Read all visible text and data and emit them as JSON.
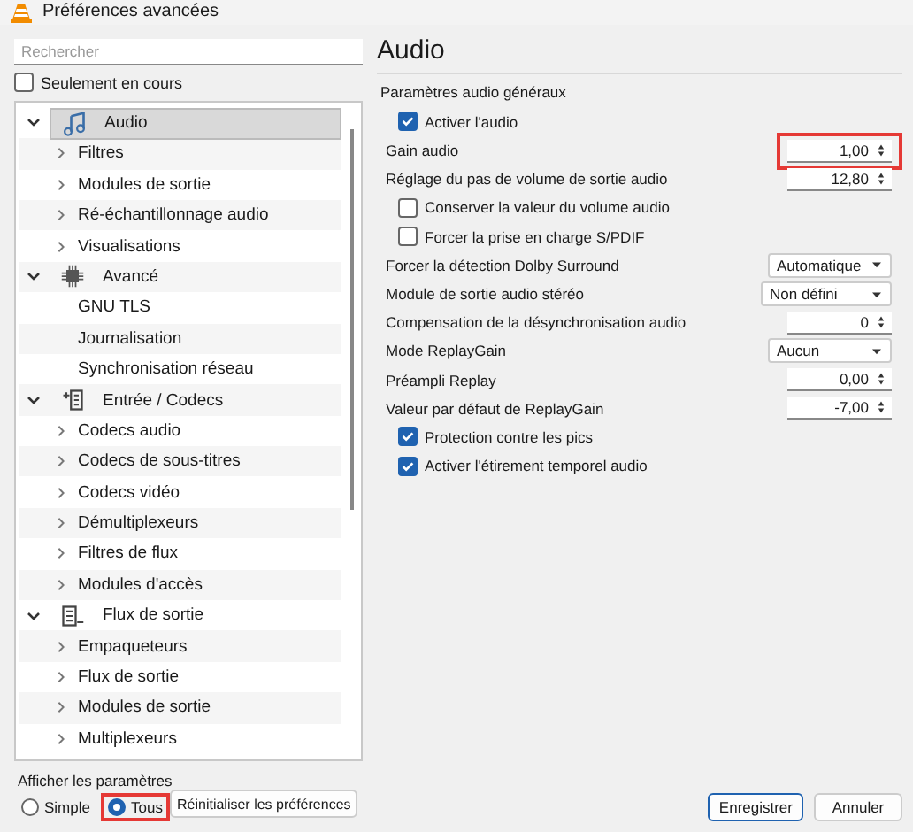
{
  "window": {
    "title": "Préférences avancées"
  },
  "search": {
    "placeholder": "Rechercher"
  },
  "only_current": {
    "label": "Seulement en cours",
    "checked": false
  },
  "tree": [
    {
      "label": "Audio",
      "expanded": true,
      "selected": true,
      "children": [
        {
          "label": "Filtres",
          "expandable": true
        },
        {
          "label": "Modules de sortie",
          "expandable": true
        },
        {
          "label": "Ré-échantillonnage audio",
          "expandable": true
        },
        {
          "label": "Visualisations",
          "expandable": true
        }
      ]
    },
    {
      "label": "Avancé",
      "expanded": true,
      "selected": false,
      "children": [
        {
          "label": "GNU TLS",
          "expandable": false
        },
        {
          "label": "Journalisation",
          "expandable": false
        },
        {
          "label": "Synchronisation réseau",
          "expandable": false
        }
      ]
    },
    {
      "label": "Entrée / Codecs",
      "expanded": true,
      "selected": false,
      "children": [
        {
          "label": "Codecs audio",
          "expandable": true
        },
        {
          "label": "Codecs de sous-titres",
          "expandable": true
        },
        {
          "label": "Codecs vidéo",
          "expandable": true
        },
        {
          "label": "Démultiplexeurs",
          "expandable": true
        },
        {
          "label": "Filtres de flux",
          "expandable": true
        },
        {
          "label": "Modules d'accès",
          "expandable": true
        }
      ]
    },
    {
      "label": "Flux de sortie",
      "expanded": true,
      "selected": false,
      "children": [
        {
          "label": "Empaqueteurs",
          "expandable": true
        },
        {
          "label": "Flux de sortie",
          "expandable": true
        },
        {
          "label": "Modules de sortie",
          "expandable": true
        },
        {
          "label": "Multiplexeurs",
          "expandable": true
        }
      ]
    }
  ],
  "show_settings": {
    "label": "Afficher les paramètres",
    "options": [
      {
        "label": "Simple",
        "selected": false,
        "highlighted": false
      },
      {
        "label": "Tous",
        "selected": true,
        "highlighted": true
      }
    ]
  },
  "reset_button": "Réinitialiser les préférences",
  "panel": {
    "title": "Audio",
    "section": "Paramètres audio généraux",
    "settings": [
      {
        "kind": "checkbox",
        "label": "Activer l'audio",
        "checked": true
      },
      {
        "kind": "spin",
        "label": "Gain audio",
        "value": "1,00",
        "highlighted": true
      },
      {
        "kind": "spin",
        "label": "Réglage du pas de volume de sortie audio",
        "value": "12,80",
        "highlighted": false
      },
      {
        "kind": "checkbox",
        "label": "Conserver la valeur du volume audio",
        "checked": false
      },
      {
        "kind": "checkbox",
        "label": "Forcer la prise en charge S/PDIF",
        "checked": false
      },
      {
        "kind": "dropdown",
        "label": "Forcer la détection Dolby Surround",
        "value": "Automatique",
        "wide": false
      },
      {
        "kind": "dropdown",
        "label": "Module de sortie audio stéréo",
        "value": "Non défini",
        "wide": true
      },
      {
        "kind": "spin",
        "label": "Compensation de la désynchronisation audio",
        "value": "0",
        "highlighted": false
      },
      {
        "kind": "dropdown",
        "label": "Mode ReplayGain",
        "value": "Aucun",
        "wide": false
      },
      {
        "kind": "spin",
        "label": "Préampli Replay",
        "value": "0,00",
        "highlighted": false
      },
      {
        "kind": "spin",
        "label": "Valeur par défaut de ReplayGain",
        "value": "-7,00",
        "highlighted": false
      },
      {
        "kind": "checkbox",
        "label": "Protection contre les pics",
        "checked": true
      },
      {
        "kind": "checkbox",
        "label": "Activer l'étirement temporel audio",
        "checked": true
      }
    ]
  },
  "buttons": [
    {
      "label": "Enregistrer",
      "default": true
    },
    {
      "label": "Annuler",
      "default": false
    }
  ]
}
